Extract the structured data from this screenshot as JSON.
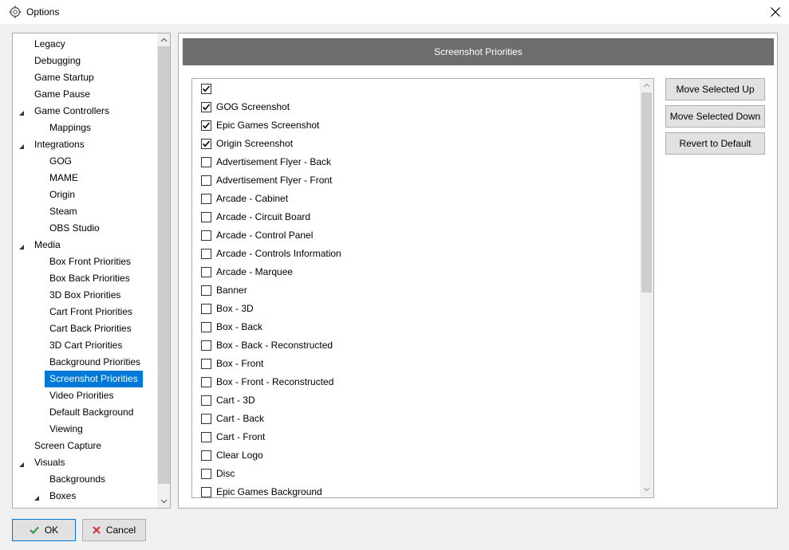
{
  "window": {
    "title": "Options"
  },
  "tree": {
    "items": [
      {
        "label": "Legacy",
        "level": 0
      },
      {
        "label": "Debugging",
        "level": 0
      },
      {
        "label": "Game Startup",
        "level": 0
      },
      {
        "label": "Game Pause",
        "level": 0
      },
      {
        "label": "Game Controllers",
        "level": 0,
        "expanded": true
      },
      {
        "label": "Mappings",
        "level": 1
      },
      {
        "label": "Integrations",
        "level": 0,
        "expanded": true
      },
      {
        "label": "GOG",
        "level": 1
      },
      {
        "label": "MAME",
        "level": 1
      },
      {
        "label": "Origin",
        "level": 1
      },
      {
        "label": "Steam",
        "level": 1
      },
      {
        "label": "OBS Studio",
        "level": 1
      },
      {
        "label": "Media",
        "level": 0,
        "expanded": true
      },
      {
        "label": "Box Front Priorities",
        "level": 1
      },
      {
        "label": "Box Back Priorities",
        "level": 1
      },
      {
        "label": "3D Box Priorities",
        "level": 1
      },
      {
        "label": "Cart Front Priorities",
        "level": 1
      },
      {
        "label": "Cart Back Priorities",
        "level": 1
      },
      {
        "label": "3D Cart Priorities",
        "level": 1
      },
      {
        "label": "Background Priorities",
        "level": 1
      },
      {
        "label": "Screenshot Priorities",
        "level": 1,
        "selected": true
      },
      {
        "label": "Video Priorities",
        "level": 1
      },
      {
        "label": "Default Background",
        "level": 1
      },
      {
        "label": "Viewing",
        "level": 1
      },
      {
        "label": "Screen Capture",
        "level": 0
      },
      {
        "label": "Visuals",
        "level": 0,
        "expanded": true
      },
      {
        "label": "Backgrounds",
        "level": 1
      },
      {
        "label": "Boxes",
        "level": 1,
        "expanded": true
      }
    ]
  },
  "panel": {
    "header": "Screenshot Priorities",
    "list": [
      {
        "label": "",
        "checked": true
      },
      {
        "label": "GOG Screenshot",
        "checked": true
      },
      {
        "label": "Epic Games Screenshot",
        "checked": true
      },
      {
        "label": "Origin Screenshot",
        "checked": true
      },
      {
        "label": "Advertisement Flyer - Back",
        "checked": false
      },
      {
        "label": "Advertisement Flyer - Front",
        "checked": false
      },
      {
        "label": "Arcade - Cabinet",
        "checked": false
      },
      {
        "label": "Arcade - Circuit Board",
        "checked": false
      },
      {
        "label": "Arcade - Control Panel",
        "checked": false
      },
      {
        "label": "Arcade - Controls Information",
        "checked": false
      },
      {
        "label": "Arcade - Marquee",
        "checked": false
      },
      {
        "label": "Banner",
        "checked": false
      },
      {
        "label": "Box - 3D",
        "checked": false
      },
      {
        "label": "Box - Back",
        "checked": false
      },
      {
        "label": "Box - Back - Reconstructed",
        "checked": false
      },
      {
        "label": "Box - Front",
        "checked": false
      },
      {
        "label": "Box - Front - Reconstructed",
        "checked": false
      },
      {
        "label": "Cart - 3D",
        "checked": false
      },
      {
        "label": "Cart - Back",
        "checked": false
      },
      {
        "label": "Cart - Front",
        "checked": false
      },
      {
        "label": "Clear Logo",
        "checked": false
      },
      {
        "label": "Disc",
        "checked": false
      },
      {
        "label": "Epic Games Background",
        "checked": false
      }
    ],
    "buttons": {
      "move_up": "Move Selected Up",
      "move_down": "Move Selected Down",
      "revert": "Revert to Default"
    }
  },
  "footer": {
    "ok": "OK",
    "cancel": "Cancel"
  },
  "colors": {
    "accent": "#0078d7",
    "header_bg": "#6d6d6d",
    "ok_check": "#2e9e3e",
    "cancel_x": "#d13438"
  },
  "icons": {
    "app": "gear-icon",
    "close": "close-icon",
    "ok": "checkmark-icon",
    "cancel": "cancel-x-icon"
  }
}
